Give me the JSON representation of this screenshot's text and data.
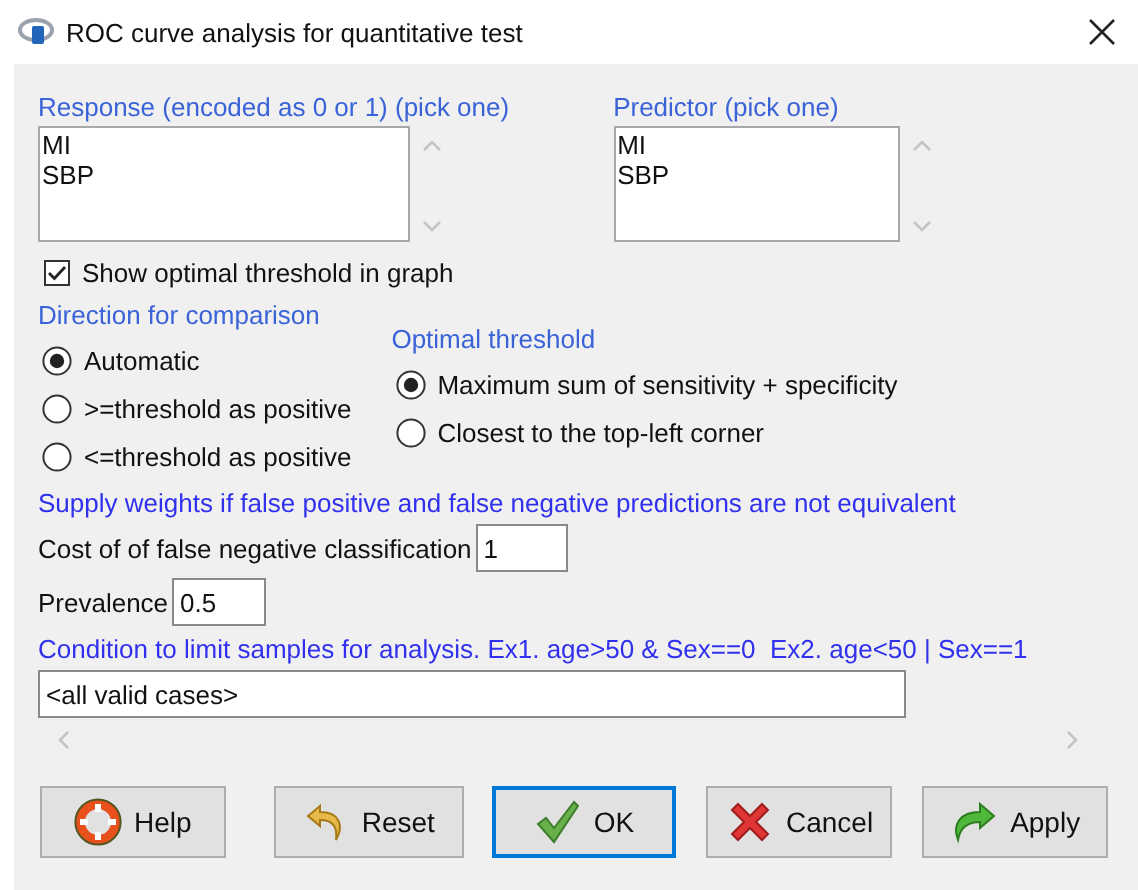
{
  "window": {
    "title": "ROC curve analysis for quantitative test"
  },
  "response": {
    "label": "Response (encoded as 0 or 1) (pick one)",
    "items": [
      "MI",
      "SBP"
    ]
  },
  "predictor": {
    "label": "Predictor (pick one)",
    "items": [
      "MI",
      "SBP"
    ]
  },
  "show_threshold": {
    "label": "Show optimal threshold in graph",
    "checked": true
  },
  "direction": {
    "label": "Direction for comparison",
    "options": [
      {
        "label": "Automatic",
        "selected": true
      },
      {
        "label": ">=threshold as positive",
        "selected": false
      },
      {
        "label": "<=threshold as positive",
        "selected": false
      }
    ]
  },
  "optimal": {
    "label": "Optimal threshold",
    "options": [
      {
        "label": "Maximum sum of sensitivity + specificity",
        "selected": true
      },
      {
        "label": "Closest to the top-left corner",
        "selected": false
      }
    ]
  },
  "weights_note": "Supply weights if false positive and false negative predictions are not equivalent",
  "cost": {
    "label": "Cost of of false negative classification",
    "value": "1"
  },
  "prevalence": {
    "label": "Prevalence",
    "value": "0.5"
  },
  "condition": {
    "label": "Condition to limit samples for analysis. Ex1. age>50 & Sex==0  Ex2. age<50 | Sex==1",
    "value": "<all valid cases>"
  },
  "buttons": [
    {
      "kind": "help",
      "label": "Help",
      "focused": false
    },
    {
      "kind": "reset",
      "label": "Reset",
      "focused": false
    },
    {
      "kind": "ok",
      "label": "OK",
      "focused": true
    },
    {
      "kind": "cancel",
      "label": "Cancel",
      "focused": false
    },
    {
      "kind": "apply",
      "label": "Apply",
      "focused": false
    }
  ]
}
